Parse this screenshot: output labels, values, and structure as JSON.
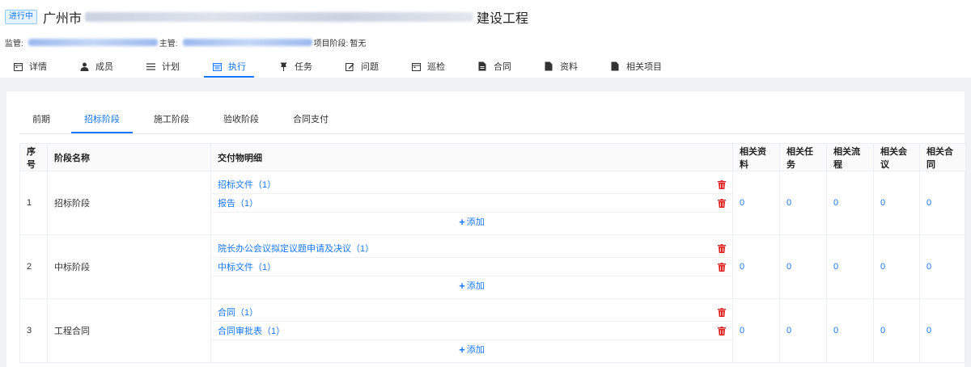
{
  "header": {
    "status_tag": "进行中",
    "title_prefix": "广州市",
    "title_suffix": "建设工程",
    "supervise_label": "监管:",
    "manager_label": "主管:",
    "phase_label": "项目阶段:",
    "phase_value": "暂无"
  },
  "top_tabs": [
    {
      "label": "详情",
      "icon": "calendar-icon"
    },
    {
      "label": "成员",
      "icon": "user-icon"
    },
    {
      "label": "计划",
      "icon": "list-icon"
    },
    {
      "label": "执行",
      "icon": "calendar-icon",
      "active": true
    },
    {
      "label": "任务",
      "icon": "pin-icon"
    },
    {
      "label": "问题",
      "icon": "edit-icon"
    },
    {
      "label": "巡检",
      "icon": "calendar-icon"
    },
    {
      "label": "合同",
      "icon": "file-icon"
    },
    {
      "label": "资料",
      "icon": "file-icon"
    },
    {
      "label": "相关项目",
      "icon": "file-icon"
    }
  ],
  "sub_tabs": [
    {
      "label": "前期"
    },
    {
      "label": "招标阶段",
      "active": true
    },
    {
      "label": "施工阶段"
    },
    {
      "label": "验收阶段"
    },
    {
      "label": "合同支付"
    }
  ],
  "table": {
    "headers": [
      "序号",
      "阶段名称",
      "交付物明细",
      "相关资料",
      "相关任务",
      "相关流程",
      "相关会议",
      "相关合同"
    ],
    "add_label": "添加",
    "rows": [
      {
        "index": "1",
        "stage": "招标阶段",
        "items": [
          "招标文件（1）",
          "报告（1）"
        ],
        "counts": [
          "0",
          "0",
          "0",
          "0",
          "0"
        ]
      },
      {
        "index": "2",
        "stage": "中标阶段",
        "items": [
          "院长办公会议拟定议题申请及决议（1）",
          "中标文件（1）"
        ],
        "counts": [
          "0",
          "0",
          "0",
          "0",
          "0"
        ]
      },
      {
        "index": "3",
        "stage": "工程合同",
        "items": [
          "合同（1）",
          "合同审批表（1）"
        ],
        "counts": [
          "0",
          "0",
          "0",
          "0",
          "0"
        ]
      }
    ]
  },
  "colors": {
    "accent": "#1677ff",
    "danger": "#e02424",
    "bg_gray": "#f0f2f5"
  }
}
